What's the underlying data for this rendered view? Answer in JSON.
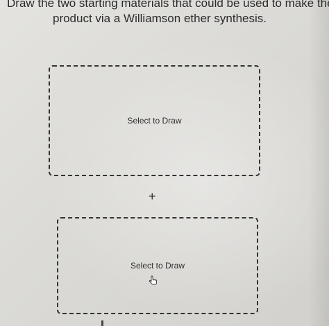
{
  "prompt": {
    "line1": "Draw the two starting materials that could be used to make the",
    "line2": "product via a Williamson ether synthesis."
  },
  "drawing_area_1": {
    "label": "Select to Draw"
  },
  "operator": {
    "symbol": "+"
  },
  "drawing_area_2": {
    "label": "Select to Draw"
  },
  "icons": {
    "cursor": "hand-pointer-icon"
  }
}
